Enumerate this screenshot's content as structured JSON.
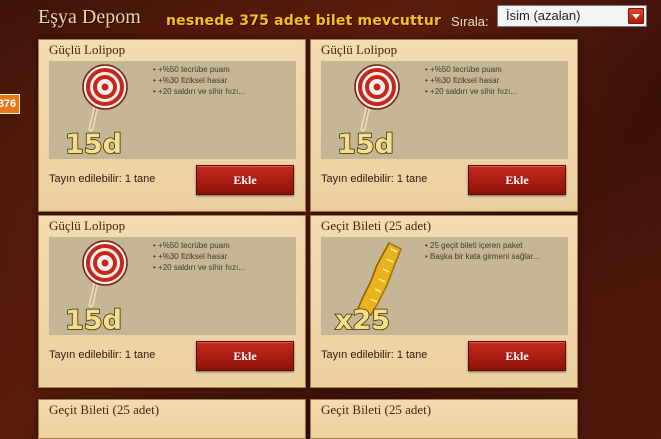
{
  "header": {
    "title": "Eşya Depom",
    "notice": "nesnede 375 adet bilet mevcuttur",
    "sort_label": "Sırala:",
    "sort_value": "İsim (azalan)"
  },
  "side_badge": "376",
  "cards": [
    {
      "title": "Güçlü Lolipop",
      "icon": "lollipop-icon",
      "badge": "15d",
      "bullets": [
        "+%50 tecrübe puanı",
        "+%30 fiziksel hasar",
        "+20 saldırı ve sihir hızı..."
      ],
      "assign": "Tayın edilebilir: 1 tane",
      "button": "Ekle"
    },
    {
      "title": "Güçlü Lolipop",
      "icon": "lollipop-icon",
      "badge": "15d",
      "bullets": [
        "+%50 tecrübe puanı",
        "+%30 fiziksel hasar",
        "+20 saldırı ve sihir hızı..."
      ],
      "assign": "Tayın edilebilir: 1 tane",
      "button": "Ekle"
    },
    {
      "title": "Güçlü Lolipop",
      "icon": "lollipop-icon",
      "badge": "15d",
      "bullets": [
        "+%50 tecrübe puanı",
        "+%30 fiziksel hasar",
        "+20 saldırı ve sihir hızı..."
      ],
      "assign": "Tayın edilebilir: 1 tane",
      "button": "Ekle"
    },
    {
      "title": "Geçit Bileti (25 adet)",
      "icon": "ticket-icon",
      "badge": "x25",
      "bullets": [
        "25 geçit bileti içeren paket",
        "Başka bir kata girmeni sağlar..."
      ],
      "assign": "Tayın edilebilir: 1 tane",
      "button": "Ekle"
    },
    {
      "title": "Geçit Bileti (25 adet)"
    },
    {
      "title": "Geçit Bileti (25 adet)"
    }
  ],
  "colors": {
    "background": "#4a150a",
    "card": "#f0d6a8",
    "button": "#b01e12",
    "notice": "#f6c21a"
  }
}
